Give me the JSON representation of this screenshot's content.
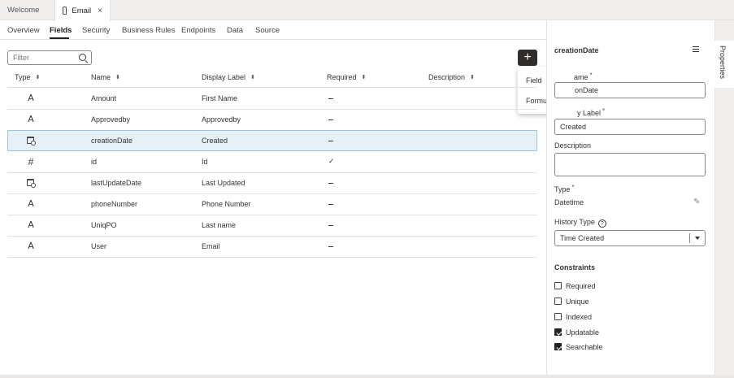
{
  "doc_tabs": [
    {
      "label": "Welcome"
    },
    {
      "label": "Email",
      "close": "×"
    }
  ],
  "subnav": [
    "Overview",
    "Fields",
    "Security",
    "Business Rules",
    "Endpoints",
    "Data",
    "Source"
  ],
  "filter": {
    "placeholder": "Filter"
  },
  "add_button": {
    "label": "+"
  },
  "menu": {
    "items": [
      "Field",
      "Formula Field"
    ]
  },
  "table": {
    "headers": [
      "Type",
      "Name",
      "Display Label",
      "Required",
      "Description"
    ],
    "rows": [
      {
        "type_icon": "text-type-icon",
        "name": "Amount",
        "label": "First Name",
        "required": "no"
      },
      {
        "type_icon": "text-type-icon",
        "name": "Approvedby",
        "label": "Approvedby",
        "required": "no"
      },
      {
        "type_icon": "datetime-type-icon",
        "name": "creationDate",
        "label": "Created",
        "required": "no",
        "selected": true
      },
      {
        "type_icon": "number-type-icon",
        "name": "id",
        "label": "Id",
        "required": "yes"
      },
      {
        "type_icon": "datetime-type-icon",
        "name": "lastUpdateDate",
        "label": "Last Updated",
        "required": "no"
      },
      {
        "type_icon": "text-type-icon",
        "name": "phoneNumber",
        "label": "Phone Number",
        "required": "no"
      },
      {
        "type_icon": "text-type-icon",
        "name": "UniqPO",
        "label": "Last name",
        "required": "no"
      },
      {
        "type_icon": "text-type-icon",
        "name": "User",
        "label": "Email",
        "required": "no"
      }
    ]
  },
  "properties": {
    "title": "creationDate",
    "sidebar_tab": "Properties",
    "field_name_label": "ame",
    "field_name_value": "onDate",
    "display_label_label": "y Label",
    "display_label_value": "Created",
    "description_label": "Description",
    "description_value": "",
    "type_label": "Type",
    "type_value": "Datetime",
    "history_type_label": "History Type",
    "history_type_value": "Time Created",
    "constraints_label": "Constraints",
    "constraints": [
      {
        "label": "Required",
        "checked": false
      },
      {
        "label": "Unique",
        "checked": false
      },
      {
        "label": "Indexed",
        "checked": false
      },
      {
        "label": "Updatable",
        "checked": true
      },
      {
        "label": "Searchable",
        "checked": true
      }
    ]
  },
  "colors": {
    "accent_dark": "#312d2a",
    "selection": "#e6f1f7",
    "selection_border": "#9cc6dc"
  }
}
